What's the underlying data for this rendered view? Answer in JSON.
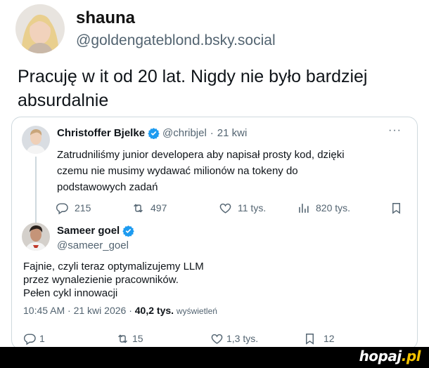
{
  "post": {
    "author_name": "shauna",
    "author_handle": "@goldengateblond.bsky.social",
    "text": "Pracuję w it od 20 lat. Nigdy nie było bardziej absurdalnie"
  },
  "quoted_tweet": {
    "author_name": "Christoffer Bjelke",
    "author_handle": "@chribjel",
    "separator": "·",
    "time": "21 kwi",
    "more_label": "···",
    "text": "Zatrudniliśmy junior developera aby napisał prosty kod, dzięki czemu nie musimy wydawać milionów na tokeny do podstawowych zadań",
    "replies": "215",
    "reposts": "497",
    "likes": "11 tys.",
    "views": "820 tys."
  },
  "reply_tweet": {
    "author_name": "Sameer goel",
    "author_handle": "@sameer_goel",
    "text_lines": [
      "Fajnie, czyli teraz optymalizujemy LLM",
      "przez wynalezienie pracowników.",
      "Pełen cykl innowacji"
    ],
    "timestamp": "10:45 AM · 21 kwi 2026 ·",
    "views_count": "40,2 tys.",
    "views_label": "wyświetleń",
    "replies": "1",
    "reposts": "15",
    "likes": "1,3 tys.",
    "bookmarks": "12"
  },
  "watermark": {
    "name": "hopaj",
    "ext": ".pl"
  },
  "colors": {
    "verified": "#1d9bf0",
    "muted": "#536471",
    "border": "#cfd9de",
    "watermark_ext": "#f2c200"
  },
  "icons": [
    "reply-icon",
    "repost-icon",
    "like-icon",
    "views-icon",
    "bookmark-icon",
    "verified-badge-icon",
    "more-icon"
  ]
}
